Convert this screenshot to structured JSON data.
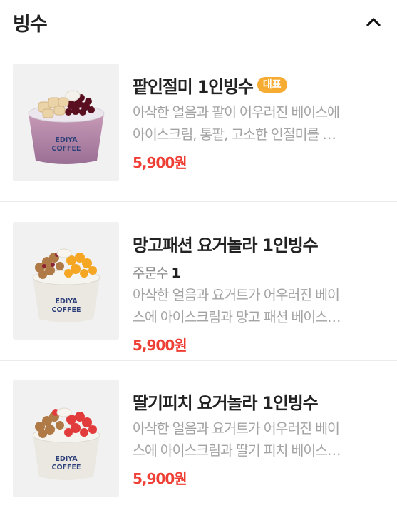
{
  "section": {
    "title": "빙수"
  },
  "items": [
    {
      "name": "팥인절미 1인빙수",
      "badge": "대표",
      "description": "아삭한 얼음과 팥이 어우러진 베이스에\n아이스크림, 통팥, 고소한 인절미를 …",
      "price": "5,900원",
      "cup_brand": "EDIYA COFFEE"
    },
    {
      "name": "망고패션 요거놀라 1인빙수",
      "order_label": "주문수",
      "order_count": "1",
      "description": "아삭한 얼음과 요거트가 어우러진 베이\n스에 아이스크림과 망고 패션 베이스…",
      "price": "5,900원",
      "cup_brand": "EDIYA COFFEE"
    },
    {
      "name": "딸기피치 요거놀라 1인빙수",
      "description": "아삭한 얼음과 요거트가 어우러진 베이\n스에 아이스크림과 딸기 피치 베이스…",
      "price": "5,900원",
      "cup_brand": "EDIYA COFFEE"
    }
  ],
  "colors": {
    "price": "#ef3f35",
    "badge": "#f6ac33"
  }
}
